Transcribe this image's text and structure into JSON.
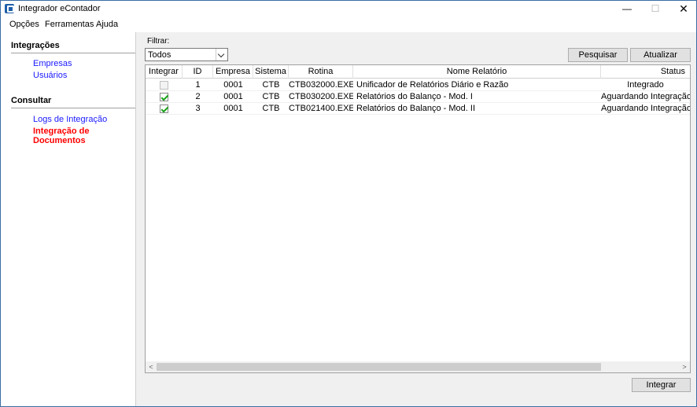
{
  "window": {
    "title": "Integrador eContador",
    "minimize_glyph": "—",
    "maximize_glyph": "☐",
    "close_glyph": "✕"
  },
  "menu": [
    "Opções",
    "Ferramentas",
    "Ajuda"
  ],
  "sidebar": {
    "sections": [
      {
        "heading": "Integrações",
        "links": [
          "Empresas",
          "Usuários"
        ]
      },
      {
        "heading": "Consultar",
        "links": [
          "Logs de Integração",
          "Integração de Documentos"
        ]
      }
    ],
    "active_link": "Integração de Documentos",
    "link_color": "#1a1aff",
    "active_color": "#ff0000"
  },
  "filter": {
    "label": "Filtrar:",
    "value": "Todos"
  },
  "buttons": {
    "search": "Pesquisar",
    "refresh": "Atualizar",
    "integrate": "Integrar"
  },
  "table": {
    "columns": [
      "Integrar",
      "ID",
      "Empresa",
      "Sistema",
      "Rotina",
      "Nome Relatório",
      "Status"
    ],
    "rows": [
      {
        "checked": false,
        "id": "1",
        "empresa": "0001",
        "sistema": "CTB",
        "rotina": "CTB032000.EXE",
        "nome": "Unificador de Relatórios Diário e Razão",
        "status": "Integrado"
      },
      {
        "checked": true,
        "id": "2",
        "empresa": "0001",
        "sistema": "CTB",
        "rotina": "CTB030200.EXE",
        "nome": "Relatórios do Balanço - Mod. I",
        "status": "Aguardando Integração"
      },
      {
        "checked": true,
        "id": "3",
        "empresa": "0001",
        "sistema": "CTB",
        "rotina": "CTB021400.EXE",
        "nome": "Relatórios do Balanço - Mod. II",
        "status": "Aguardando Integração"
      }
    ]
  },
  "scrollbar": {
    "left_glyph": "<",
    "right_glyph": ">"
  }
}
